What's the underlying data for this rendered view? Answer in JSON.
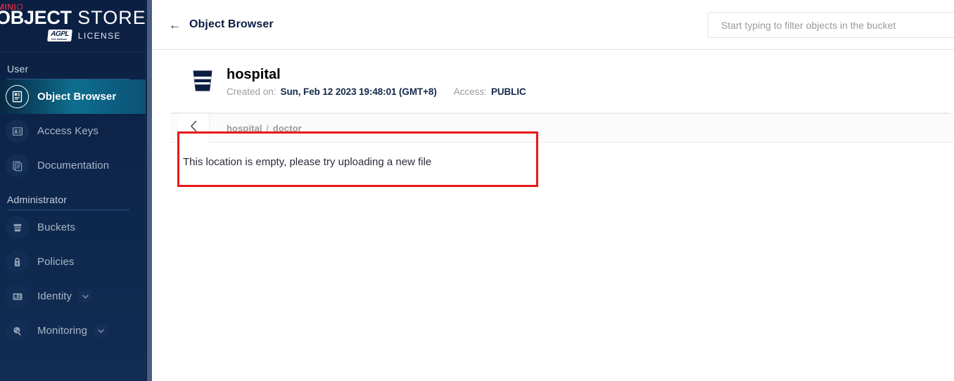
{
  "sidebar": {
    "logo": {
      "brand": "MINI",
      "brand_suffix": "O",
      "title_bold": "OBJECT",
      "title_light": " STORE",
      "badge_top": "AGPL",
      "badge_bottom": "Free Software",
      "license": "LICENSE"
    },
    "sections": [
      {
        "title": "User",
        "items": [
          {
            "label": "Object Browser",
            "icon": "object-browser-icon",
            "selected": true,
            "expandable": false
          },
          {
            "label": "Access Keys",
            "icon": "access-keys-icon",
            "selected": false,
            "expandable": false
          },
          {
            "label": "Documentation",
            "icon": "documentation-icon",
            "selected": false,
            "expandable": false
          }
        ]
      },
      {
        "title": "Administrator",
        "items": [
          {
            "label": "Buckets",
            "icon": "bucket-icon",
            "selected": false,
            "expandable": false
          },
          {
            "label": "Policies",
            "icon": "policies-lock-icon",
            "selected": false,
            "expandable": false
          },
          {
            "label": "Identity",
            "icon": "identity-card-icon",
            "selected": false,
            "expandable": true
          },
          {
            "label": "Monitoring",
            "icon": "monitoring-icon",
            "selected": false,
            "expandable": true
          }
        ]
      }
    ]
  },
  "topbar": {
    "back_arrow": "←",
    "title": "Object Browser",
    "search": {
      "value": "",
      "placeholder": "Start typing to filter objects in the bucket",
      "icon": "search-icon"
    }
  },
  "bucket": {
    "name": "hospital",
    "created_label": "Created on:",
    "created_value": "Sun, Feb 12 2023 19:48:01 (GMT+8)",
    "access_label": "Access:",
    "access_value": "PUBLIC"
  },
  "browser": {
    "back_icon": "chevron-left-icon",
    "breadcrumb_root": "hospital",
    "breadcrumb_separator": "/",
    "breadcrumb_current": "doctor",
    "empty_message": "This location is empty, please try uploading a new file"
  },
  "colors": {
    "sidebar_bg": "#0b1f42",
    "selected_nav": "#0e6e8e",
    "brand_red": "#c72c48",
    "annotation_red": "#e81919",
    "title_navy": "#081c42"
  }
}
